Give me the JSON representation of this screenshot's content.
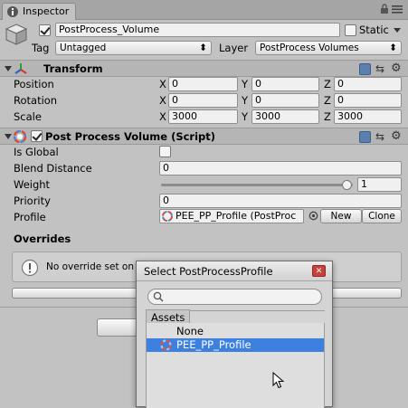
{
  "tab": {
    "title": "Inspector",
    "lock_icon": "lock-icon",
    "menu_icon": "menu-icon"
  },
  "gameobject": {
    "name": "PostProcess_Volume",
    "static_label": "Static",
    "tag_label": "Tag",
    "tag_value": "Untagged",
    "layer_label": "Layer",
    "layer_value": "PostProcess Volumes"
  },
  "transform": {
    "title": "Transform",
    "rows": [
      {
        "label": "Position",
        "x": "0",
        "y": "0",
        "z": "0"
      },
      {
        "label": "Rotation",
        "x": "0",
        "y": "0",
        "z": "0"
      },
      {
        "label": "Scale",
        "x": "3000",
        "y": "3000",
        "z": "3000"
      }
    ],
    "axis": {
      "x": "X",
      "y": "Y",
      "z": "Z"
    }
  },
  "ppv": {
    "title": "Post Process Volume (Script)",
    "is_global_label": "Is Global",
    "blend_label": "Blend Distance",
    "blend_value": "0",
    "weight_label": "Weight",
    "weight_value": "1",
    "weight_fraction": 1,
    "priority_label": "Priority",
    "priority_value": "0",
    "profile_label": "Profile",
    "profile_value": "PEE_PP_Profile (PostProc",
    "new_label": "New",
    "clone_label": "Clone",
    "overrides_label": "Overrides",
    "overrides_message": "No override set on th"
  },
  "dialog": {
    "title": "Select PostProcessProfile",
    "search_placeholder": "",
    "assets_tab": "Assets",
    "items": [
      "None",
      "PEE_PP_Profile"
    ],
    "selected_index": 1
  },
  "colors": {
    "selection": "#3d80df",
    "background": "#c2c2c2"
  }
}
